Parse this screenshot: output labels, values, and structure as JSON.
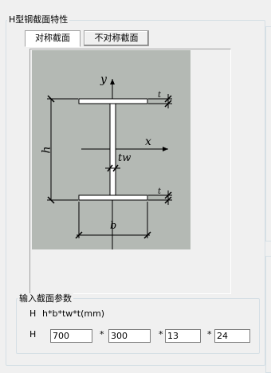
{
  "group": {
    "title": "H型钢截面特性"
  },
  "tabs": [
    {
      "label": "对称截面",
      "active": true
    },
    {
      "label": "不对称截面",
      "active": false
    }
  ],
  "diagram": {
    "axis_y": "y",
    "axis_x": "x",
    "dim_h": "h",
    "dim_b": "b",
    "dim_tw": "tw",
    "dim_t_top": "t",
    "dim_t_bottom": "t",
    "background": "#b4b9b4"
  },
  "input_group": {
    "title": "输入截面参数",
    "formula_prefix": "H",
    "formula": "h*b*tw*t(mm)",
    "row_prefix": "H",
    "separator": "*",
    "values": {
      "h": "700",
      "b": "300",
      "tw": "13",
      "t": "24"
    }
  }
}
